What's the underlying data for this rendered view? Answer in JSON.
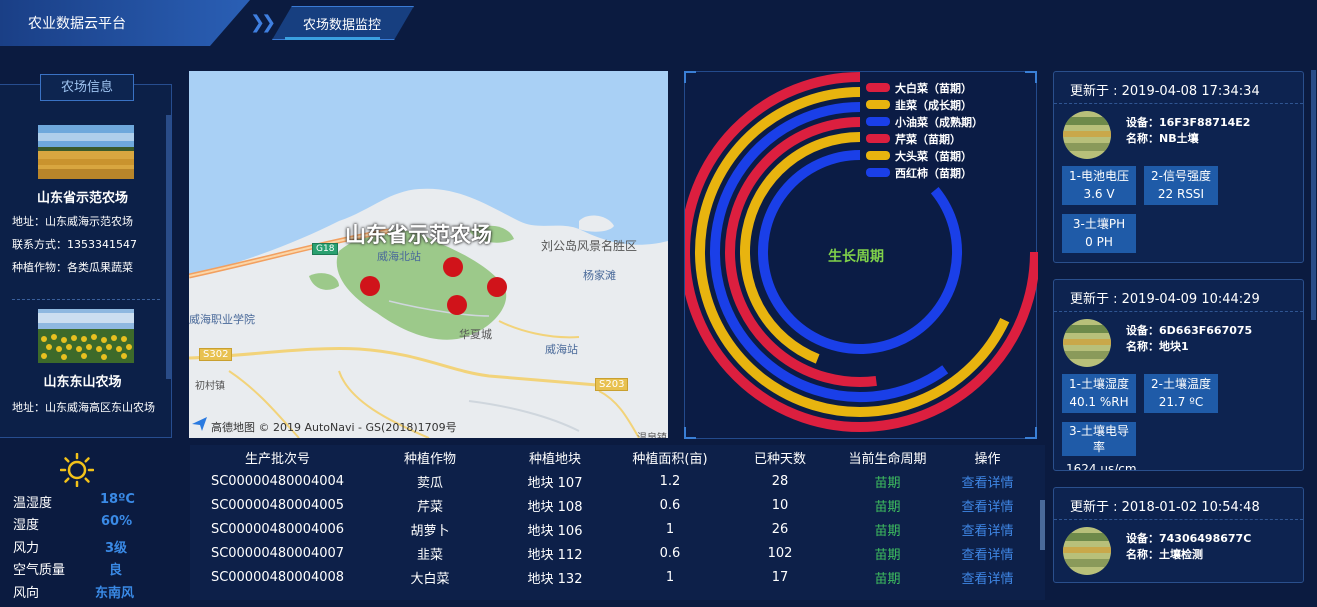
{
  "nav": {
    "app_title": "农业数据云平台",
    "current_page": "农场数据监控",
    "separator": "»"
  },
  "farm_panel": {
    "header": "农场信息",
    "farms": [
      {
        "name": "山东省示范农场",
        "address": "地址：山东威海示范农场",
        "contact": "联系方式：1353341547",
        "crops": "种植作物：各类瓜果蔬菜"
      },
      {
        "name": "山东东山农场",
        "address": "地址：山东威海高区东山农场",
        "contact": "",
        "crops": ""
      }
    ]
  },
  "map": {
    "title": "山东省示范农场",
    "labels": {
      "station_north": "威海北站",
      "scenic": "刘公岛风景名胜区",
      "yangjiatan": "杨家滩",
      "college": "威海职业学院",
      "huaxiacheng": "华夏城",
      "weihai_station": "威海站",
      "chucun": "初村镇",
      "wenquan": "温泉镇"
    },
    "road_badges": {
      "g18": "G18",
      "s302": "S302",
      "s203": "S203"
    },
    "copyright": "© 2019 AutoNavi - GS(2018)1709号",
    "provider": "高德地图"
  },
  "growth_chart": {
    "center_label": "生长周期",
    "series": [
      {
        "name": "大白菜（苗期）",
        "color": "#dc1f3f",
        "fraction": 0.75
      },
      {
        "name": "韭菜（成长期）",
        "color": "#e8b40f",
        "fraction": 0.68
      },
      {
        "name": "小油菜（成熟期）",
        "color": "#1a3fe8",
        "fraction": 0.6
      },
      {
        "name": "芹菜（苗期）",
        "color": "#dc1f3f",
        "fraction": 0.52
      },
      {
        "name": "大头菜（苗期）",
        "color": "#e8b40f",
        "fraction": 0.44
      },
      {
        "name": "西红柿（苗期）",
        "color": "#1a3fe8",
        "fraction": 0.86
      }
    ]
  },
  "devices": [
    {
      "updated": "更新于 : 2019-04-08 17:34:34",
      "device": "设备：16F3F88714E2",
      "name": "名称：NB土壤",
      "sensors": [
        {
          "label": "1-电池电压",
          "value": "3.6 V"
        },
        {
          "label": "2-信号强度",
          "value": "22 RSSI"
        },
        {
          "label": "3-土壤PH",
          "value": "0 PH"
        }
      ]
    },
    {
      "updated": "更新于 : 2019-04-09 10:44:29",
      "device": "设备：6D663F667075",
      "name": "名称：地块1",
      "sensors": [
        {
          "label": "1-土壤湿度",
          "value": "40.1 %RH"
        },
        {
          "label": "2-土壤温度",
          "value": "21.7 ºC"
        },
        {
          "label": "3-土壤电导率",
          "value": "1624 us/cm"
        }
      ]
    },
    {
      "updated": "更新于 : 2018-01-02 10:54:48",
      "device": "设备：74306498677C",
      "name": "名称：土壤检测",
      "sensors": []
    }
  ],
  "weather": {
    "icon": "sun-icon",
    "rows": [
      {
        "label": "温湿度",
        "value": "18ºC"
      },
      {
        "label": "湿度",
        "value": "60%"
      },
      {
        "label": "风力",
        "value": "3级"
      },
      {
        "label": "空气质量",
        "value": "良"
      },
      {
        "label": "风向",
        "value": "东南风"
      }
    ]
  },
  "table": {
    "headers": [
      "生产批次号",
      "种植作物",
      "种植地块",
      "种植面积(亩)",
      "已种天数",
      "当前生命周期",
      "操作"
    ],
    "rows": [
      [
        "SC00000480004004",
        "荬瓜",
        "地块 107",
        "1.2",
        "28",
        "苗期",
        "查看详情"
      ],
      [
        "SC00000480004005",
        "芹菜",
        "地块 108",
        "0.6",
        "10",
        "苗期",
        "查看详情"
      ],
      [
        "SC00000480004006",
        "胡萝卜",
        "地块 106",
        "1",
        "26",
        "苗期",
        "查看详情"
      ],
      [
        "SC00000480004007",
        "韭菜",
        "地块 112",
        "0.6",
        "102",
        "苗期",
        "查看详情"
      ],
      [
        "SC00000480004008",
        "大白菜",
        "地块 132",
        "1",
        "17",
        "苗期",
        "查看详情"
      ]
    ]
  }
}
